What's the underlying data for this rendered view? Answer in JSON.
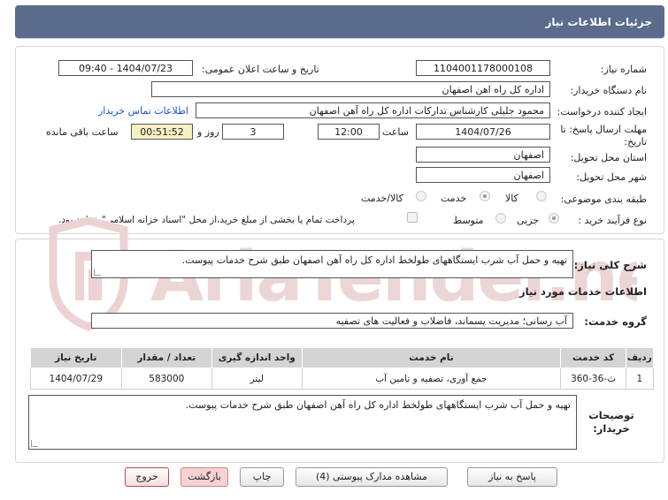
{
  "header": {
    "title": "جزئیات اطلاعات نیاز"
  },
  "form": {
    "need_number_label": "شماره نیاز:",
    "need_number_value": "1104001178000108",
    "announce_label": "تاریخ و ساعت اعلان عمومی:",
    "announce_value": "1404/07/23 - 09:40",
    "buyer_org_label": "نام دستگاه خریدار:",
    "buyer_org_value": "اداره کل راه اهن اصفهان",
    "creator_label": "ایجاد کننده درخواست:",
    "creator_value": "محمود جلیلی کارشناس تدارکات اداره کل راه آهن اصفهان",
    "contact_link": "اطلاعات تماس خریدار",
    "deadline_label": "مهلت ارسال پاسخ: تا تاریخ:",
    "deadline_date": "1404/07/26",
    "time_label": "ساعت",
    "deadline_time": "12:00",
    "days_value": "3",
    "days_label": "روز و",
    "remaining_value": "00:51:52",
    "remaining_label": "ساعت باقی مانده",
    "province_label": "استان محل تحویل:",
    "province_value": "اصفهان",
    "city_label": "شهر محل تحویل:",
    "city_value": "اصفهان",
    "category_label": "طبقه بندی موضوعی:",
    "category_options": [
      "کالا",
      "خدمت",
      "کالا/خدمت"
    ],
    "category_selected": "خدمت",
    "process_label": "نوع فرآیند خرید :",
    "process_options": [
      "جزیی",
      "متوسط"
    ],
    "process_selected": "جزیی",
    "payment_note": "پرداخت تمام یا بخشی از مبلغ خرید،از محل \"اسناد خزانه اسلامی\" خواهد بود."
  },
  "details": {
    "summary_label": "شرح کلی نیاز:",
    "summary_value": "تهیه و حمل آب شرب ایستگاههای طولخط اداره کل راه آهن اصفهان طبق شرح خدمات پیوست.",
    "services_heading": "اطلاعات خدمات مورد نیاز",
    "service_group_label": "گروه خدمت:",
    "service_group_value": "آب رسانی؛ مدیریت پسماند، فاضلاب و فعالیت های تصفیه",
    "table": {
      "headers": [
        "ردیف",
        "کد خدمت",
        "نام خدمت",
        "واحد اندازه گیری",
        "تعداد / مقدار",
        "تاریخ نیاز"
      ],
      "rows": [
        [
          "1",
          "ث-36-360",
          "جمع آوری، تصفیه و تامین آب",
          "لیتر",
          "583000",
          "1404/07/29"
        ]
      ]
    },
    "buyer_notes_label": "توضیحات خریدار:",
    "buyer_notes_value": "تهیه و حمل آب شرب ایستگاههای طولخط اداره کل راه آهن اصفهان طبق شرح خدمات پیوست."
  },
  "buttons": {
    "reply": "پاسخ به نیاز",
    "attachments": "مشاهده مدارک پیوستی (4)",
    "print": "چاپ",
    "back": "بازگشت",
    "exit": "خروج"
  },
  "watermark": {
    "text": "AriaTender.net",
    "color": "#e8c9c9"
  },
  "colors": {
    "header_bg": "#5a6b8c",
    "link": "#1a55c9",
    "remaining_bg": "#f6f0c4"
  }
}
